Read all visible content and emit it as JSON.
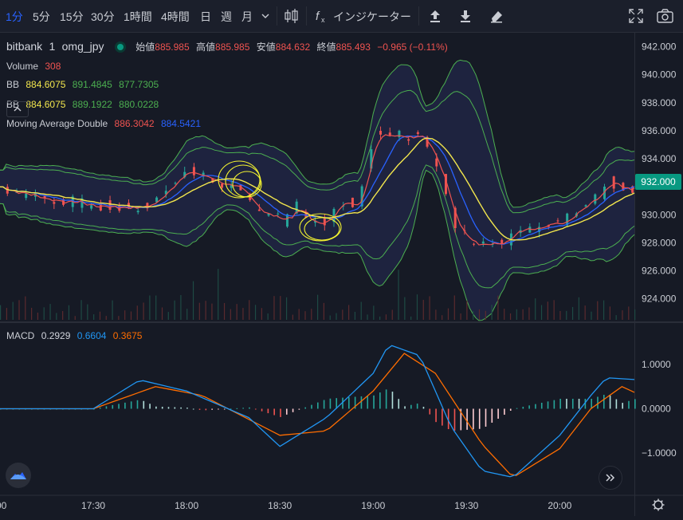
{
  "toolbar": {
    "timeframes": [
      "1分",
      "5分",
      "15分",
      "30分",
      "1時間",
      "4時間",
      "日",
      "週",
      "月"
    ],
    "indicators_label": "インジケーター"
  },
  "legend": {
    "exchange": "bitbank",
    "interval": "1",
    "pair": "omg_jpy",
    "open_label": "始値",
    "open": "885.985",
    "high_label": "高値",
    "high": "885.985",
    "low_label": "安値",
    "low": "884.632",
    "close_label": "終値",
    "close": "885.493",
    "change": "−0.965 (−0.11%)",
    "volume_label": "Volume",
    "volume": "308",
    "bb1": {
      "label": "BB",
      "basis": "884.6075",
      "upper": "891.4845",
      "lower": "877.7305"
    },
    "bb2": {
      "label": "BB",
      "basis": "884.6075",
      "upper": "889.1922",
      "lower": "880.0228"
    },
    "ma": {
      "label": "Moving Average Double",
      "v1": "886.3042",
      "v2": "884.5421"
    },
    "macd": {
      "label": "MACD",
      "hist": "0.2929",
      "macd": "0.6604",
      "signal": "0.3675"
    }
  },
  "price_axis": [
    "942.000",
    "940.000",
    "938.000",
    "936.000",
    "934.000",
    "932.000",
    "930.000",
    "928.000",
    "926.000",
    "924.000"
  ],
  "current_price": "932.000",
  "macd_axis": [
    "1.0000",
    "0.0000",
    "−1.0000"
  ],
  "time_axis": [
    ":00",
    "17:30",
    "18:00",
    "18:30",
    "19:00",
    "19:30",
    "20:00"
  ],
  "colors": {
    "background": "#161a25",
    "up": "#26a69a",
    "down": "#ef5350",
    "bb_outer": "#4caf50",
    "bb_basis": "#f2e64d",
    "ma_fast": "#ef5350",
    "ma_slow": "#2962ff",
    "macd": "#2196f3",
    "signal": "#ff6d00",
    "annotation": "#f2f230"
  },
  "chart_data": {
    "type": "candlestick",
    "title": "bitbank 1 omg_jpy",
    "price_ylim": [
      922.5,
      943
    ],
    "x_range": [
      "17:00",
      "20:24"
    ],
    "price_path": [
      [
        "17:00",
        932.0
      ],
      [
        "17:10",
        931.3
      ],
      [
        "17:20",
        931.0
      ],
      [
        "17:30",
        930.6
      ],
      [
        "17:40",
        930.6
      ],
      [
        "17:45",
        930.5
      ],
      [
        "17:50",
        931.0
      ],
      [
        "17:55",
        932.6
      ],
      [
        "18:00",
        933.0
      ],
      [
        "18:10",
        932.4
      ],
      [
        "18:20",
        931.0
      ],
      [
        "18:25",
        930.0
      ],
      [
        "18:30",
        929.6
      ],
      [
        "18:35",
        930.5
      ],
      [
        "18:40",
        929.2
      ],
      [
        "18:45",
        929.8
      ],
      [
        "18:50",
        930.9
      ],
      [
        "18:55",
        931.0
      ],
      [
        "19:00",
        936.0
      ],
      [
        "19:05",
        935.8
      ],
      [
        "19:10",
        935.7
      ],
      [
        "19:15",
        935.9
      ],
      [
        "19:20",
        933.5
      ],
      [
        "19:25",
        929.5
      ],
      [
        "19:30",
        928.3
      ],
      [
        "19:35",
        928.0
      ],
      [
        "19:40",
        927.8
      ],
      [
        "19:45",
        928.7
      ],
      [
        "19:50",
        928.8
      ],
      [
        "20:00",
        929.3
      ],
      [
        "20:05",
        930.2
      ],
      [
        "20:10",
        931.0
      ],
      [
        "20:15",
        932.3
      ],
      [
        "20:20",
        932.0
      ],
      [
        "20:24",
        932.0
      ]
    ],
    "macd_series": [
      {
        "name": "MACD",
        "points": [
          [
            "17:00",
            0.0
          ],
          [
            "17:30",
            0.0
          ],
          [
            "17:45",
            0.65
          ],
          [
            "18:00",
            0.4
          ],
          [
            "18:20",
            -0.2
          ],
          [
            "18:30",
            -0.85
          ],
          [
            "18:45",
            -0.2
          ],
          [
            "19:00",
            0.8
          ],
          [
            "19:05",
            1.45
          ],
          [
            "19:15",
            1.2
          ],
          [
            "19:25",
            -0.4
          ],
          [
            "19:35",
            -1.4
          ],
          [
            "19:45",
            -1.55
          ],
          [
            "20:00",
            -0.6
          ],
          [
            "20:10",
            0.3
          ],
          [
            "20:15",
            0.7
          ],
          [
            "20:24",
            0.66
          ]
        ]
      },
      {
        "name": "Signal",
        "points": [
          [
            "17:00",
            0.0
          ],
          [
            "17:30",
            0.0
          ],
          [
            "17:50",
            0.5
          ],
          [
            "18:05",
            0.3
          ],
          [
            "18:30",
            -0.6
          ],
          [
            "18:45",
            -0.5
          ],
          [
            "19:00",
            0.4
          ],
          [
            "19:10",
            1.25
          ],
          [
            "19:20",
            0.8
          ],
          [
            "19:35",
            -0.8
          ],
          [
            "19:45",
            -1.55
          ],
          [
            "20:00",
            -0.9
          ],
          [
            "20:10",
            0.0
          ],
          [
            "20:20",
            0.5
          ],
          [
            "20:24",
            0.37
          ]
        ]
      }
    ],
    "macd_ylim": [
      -1.9,
      1.9
    ]
  }
}
